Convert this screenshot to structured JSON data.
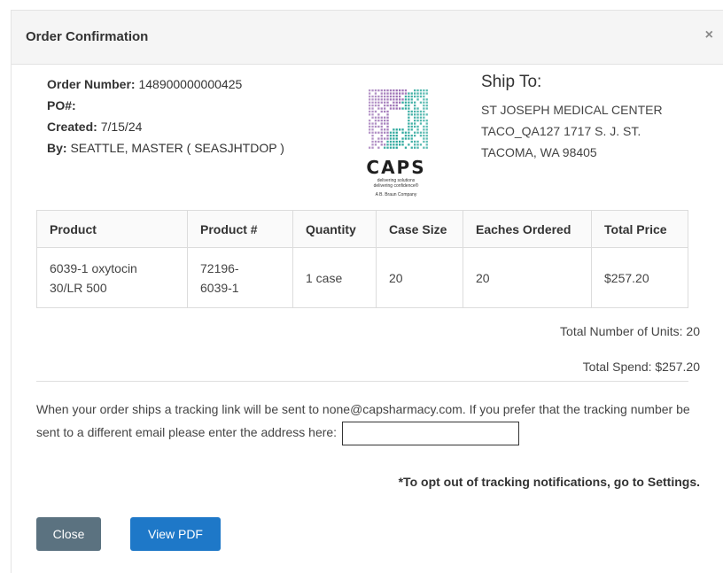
{
  "modal": {
    "title": "Order Confirmation",
    "close_glyph": "×"
  },
  "order": {
    "number_label": "Order Number:",
    "number_value": "148900000000425",
    "po_label": "PO#:",
    "po_value": "",
    "created_label": "Created:",
    "created_value": "7/15/24",
    "by_label": "By:",
    "by_value": "SEATTLE, MASTER ( SEASJHTDOP )"
  },
  "logo": {
    "word": "CAPS",
    "tagline_1": "delivering solutions",
    "tagline_2": "delivering confidence®",
    "parent": "A B. Braun Company",
    "colors": {
      "purple": "#9b6fb4",
      "teal": "#27a59a"
    }
  },
  "ship_to": {
    "title": "Ship To:",
    "line1": "ST JOSEPH MEDICAL CENTER",
    "line2": "TACO_QA127 1717 S. J. ST.",
    "line3": "TACOMA, WA 98405"
  },
  "table": {
    "headers": [
      "Product",
      "Product #",
      "Quantity",
      "Case Size",
      "Eaches Ordered",
      "Total Price"
    ],
    "rows": [
      [
        "6039-1 oxytocin 30/LR 500",
        "72196-6039-1",
        "1 case",
        "20",
        "20",
        "$257.20"
      ]
    ]
  },
  "totals": {
    "units": "Total Number of Units: 20",
    "spend": "Total Spend: $257.20"
  },
  "tracking": {
    "text": "When your order ships a tracking link will be sent to none@capsharmacy.com. If you prefer that the tracking number be sent to a different email please enter the address here:",
    "email_value": "",
    "opt_out": "*To opt out of tracking notifications, go to Settings."
  },
  "buttons": {
    "close": "Close",
    "pdf": "View PDF"
  },
  "colors": {
    "close_button": "#5b7280",
    "pdf_button": "#1e78c8"
  }
}
